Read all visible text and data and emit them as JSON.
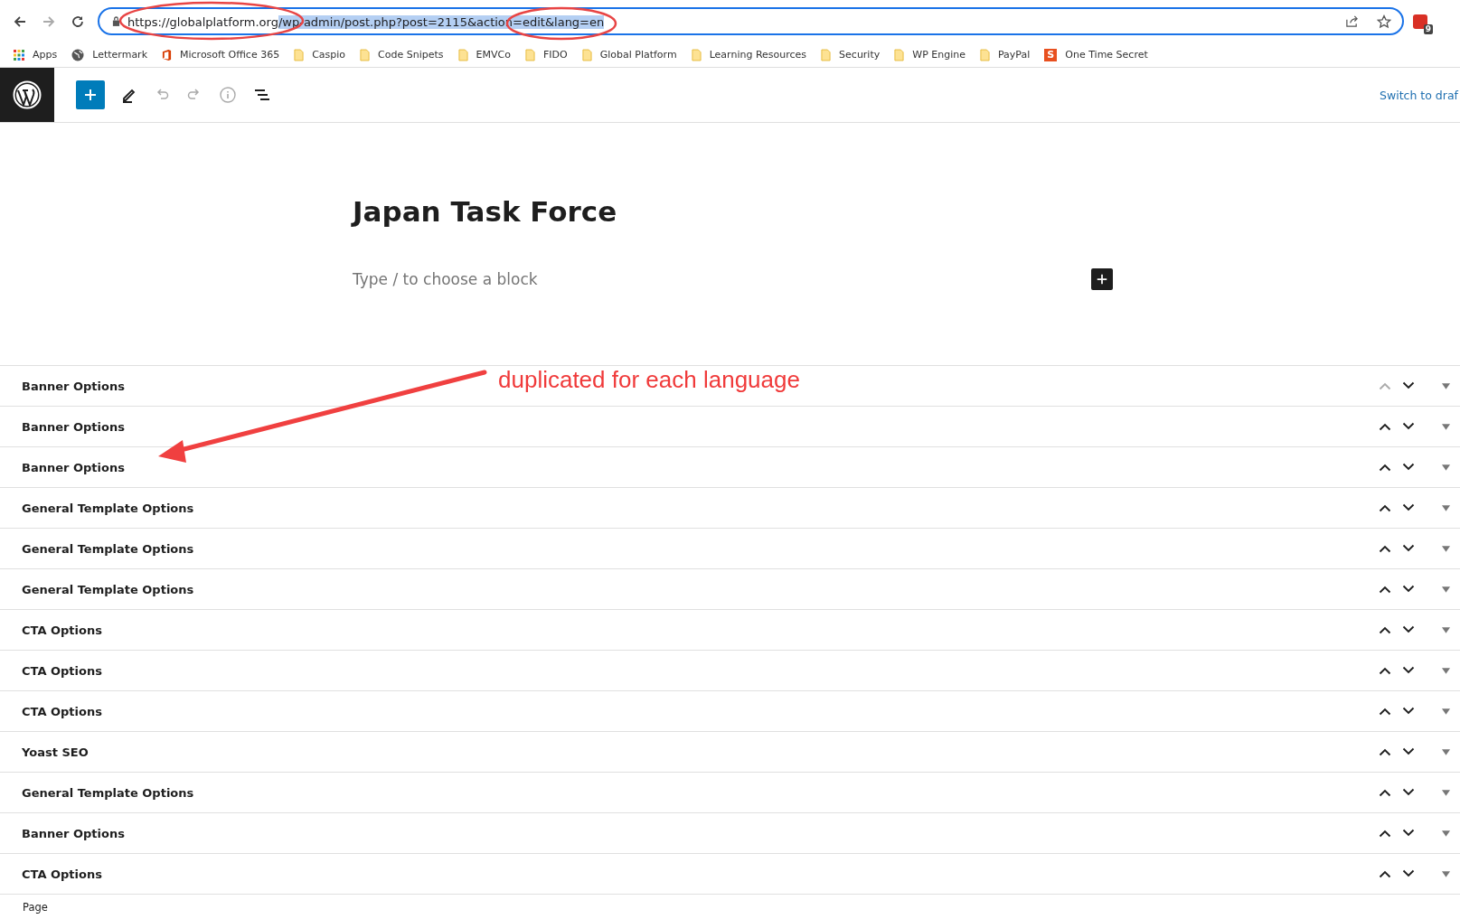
{
  "browser": {
    "url_unselected": "https://globalplatform.org",
    "url_selected": "/wp-admin/post.php?post=2115&action=edit&lang=en",
    "extension_badge": "9",
    "bookmarks": [
      {
        "kind": "apps",
        "label": "Apps"
      },
      {
        "kind": "globe",
        "label": "Lettermark"
      },
      {
        "kind": "office",
        "label": "Microsoft Office 365"
      },
      {
        "kind": "folder",
        "label": "Caspio"
      },
      {
        "kind": "folder",
        "label": "Code Snipets"
      },
      {
        "kind": "folder",
        "label": "EMVCo"
      },
      {
        "kind": "folder",
        "label": "FIDO"
      },
      {
        "kind": "folder",
        "label": "Global Platform"
      },
      {
        "kind": "folder",
        "label": "Learning Resources"
      },
      {
        "kind": "folder",
        "label": "Security"
      },
      {
        "kind": "folder",
        "label": "WP Engine"
      },
      {
        "kind": "folder",
        "label": "PayPal"
      },
      {
        "kind": "s-logo",
        "label": "One Time Secret",
        "letter": "S"
      }
    ]
  },
  "editor": {
    "switch_link": "Switch to draf",
    "title": "Japan Task Force",
    "block_placeholder": "Type / to choose a block"
  },
  "panels": [
    {
      "title": "Banner Options",
      "move_up_disabled": true
    },
    {
      "title": "Banner Options",
      "move_up_disabled": false
    },
    {
      "title": "Banner Options",
      "move_up_disabled": false
    },
    {
      "title": "General Template Options",
      "move_up_disabled": false
    },
    {
      "title": "General Template Options",
      "move_up_disabled": false
    },
    {
      "title": "General Template Options",
      "move_up_disabled": false
    },
    {
      "title": "CTA Options",
      "move_up_disabled": false
    },
    {
      "title": "CTA Options",
      "move_up_disabled": false
    },
    {
      "title": "CTA Options",
      "move_up_disabled": false
    },
    {
      "title": "Yoast SEO",
      "move_up_disabled": false
    },
    {
      "title": "General Template Options",
      "move_up_disabled": false
    },
    {
      "title": "Banner Options",
      "move_up_disabled": false
    },
    {
      "title": "CTA Options",
      "move_up_disabled": false
    }
  ],
  "footer": {
    "breadcrumb": "Page"
  },
  "annotation": {
    "text": "duplicated for each language"
  }
}
